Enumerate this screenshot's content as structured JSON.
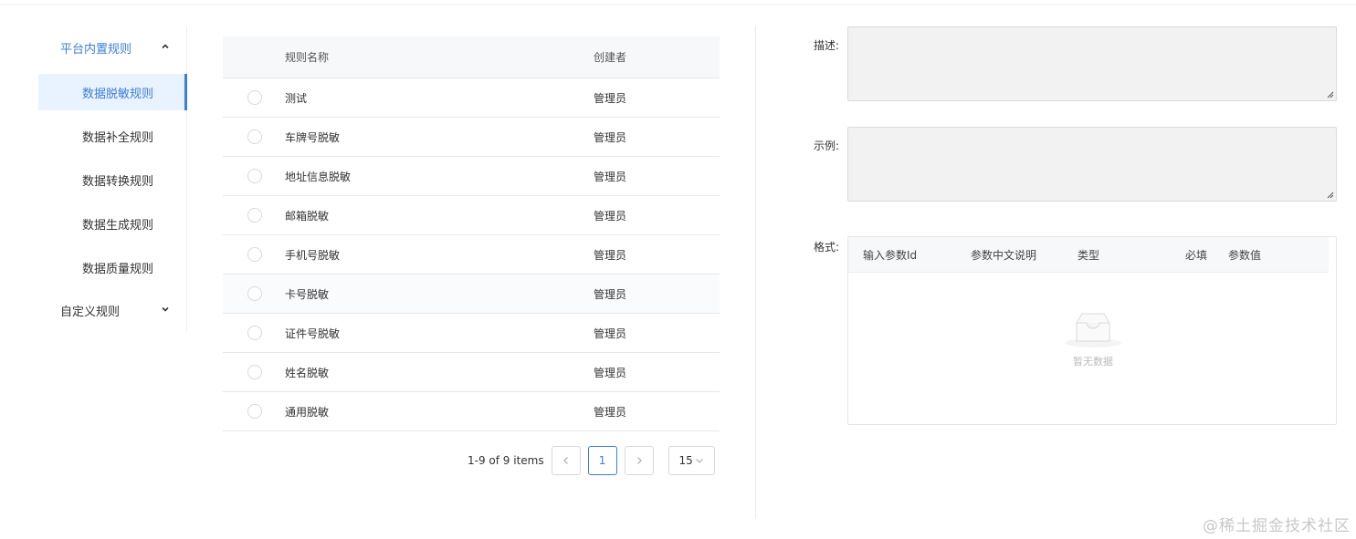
{
  "sidebar": {
    "groups": [
      {
        "label": "平台内置规则",
        "expanded": true
      },
      {
        "label": "自定义规则",
        "expanded": false
      }
    ],
    "items": [
      {
        "label": "数据脱敏规则",
        "active": true
      },
      {
        "label": "数据补全规则",
        "active": false
      },
      {
        "label": "数据转换规则",
        "active": false
      },
      {
        "label": "数据生成规则",
        "active": false
      },
      {
        "label": "数据质量规则",
        "active": false
      }
    ],
    "accent_color": "#3c7ddb"
  },
  "table": {
    "columns": {
      "name": "规则名称",
      "creator": "创建者"
    },
    "rows": [
      {
        "name": "测试",
        "creator": "管理员"
      },
      {
        "name": "车牌号脱敏",
        "creator": "管理员"
      },
      {
        "name": "地址信息脱敏",
        "creator": "管理员"
      },
      {
        "name": "邮箱脱敏",
        "creator": "管理员"
      },
      {
        "name": "手机号脱敏",
        "creator": "管理员"
      },
      {
        "name": "卡号脱敏",
        "creator": "管理员"
      },
      {
        "name": "证件号脱敏",
        "creator": "管理员"
      },
      {
        "name": "姓名脱敏",
        "creator": "管理员"
      },
      {
        "name": "通用脱敏",
        "creator": "管理员"
      }
    ]
  },
  "pagination": {
    "total_text": "1-9 of 9 items",
    "current_page": "1",
    "page_size": "15"
  },
  "form": {
    "description_label": "描述:",
    "example_label": "示例:",
    "format_label": "格式:",
    "format_columns": [
      "输入参数Id",
      "参数中文说明",
      "类型",
      "必填",
      "参数值"
    ],
    "empty_text": "暂无数据"
  },
  "watermark": "@稀土掘金技术社区"
}
